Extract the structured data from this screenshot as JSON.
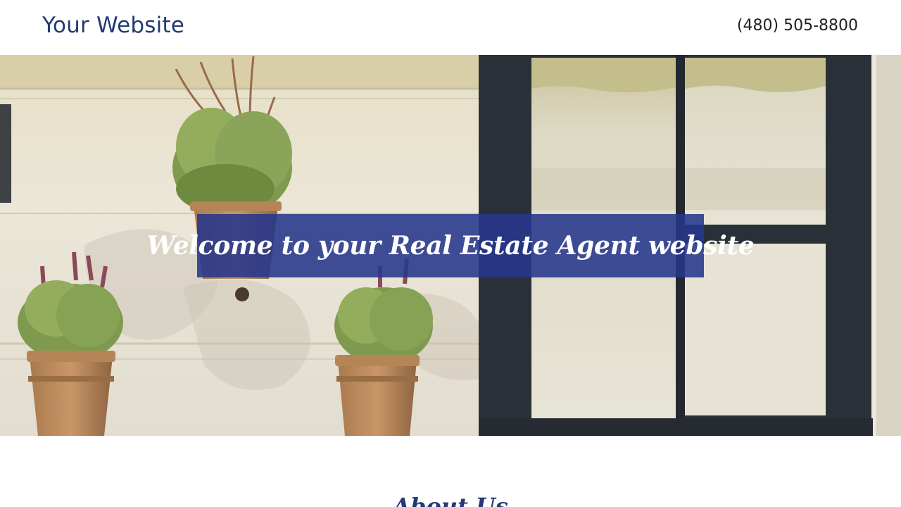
{
  "header": {
    "site_title": "Your Website",
    "phone": "(480) 505-8800"
  },
  "hero": {
    "banner_text": "Welcome to your Real Estate Agent website",
    "image": "hanging lavender pots on white wall beside dark window"
  },
  "about": {
    "heading": "About Us"
  },
  "colors": {
    "brand": "#243a73",
    "banner_bg": "#26378c",
    "phone_text": "#1f1f1f"
  }
}
